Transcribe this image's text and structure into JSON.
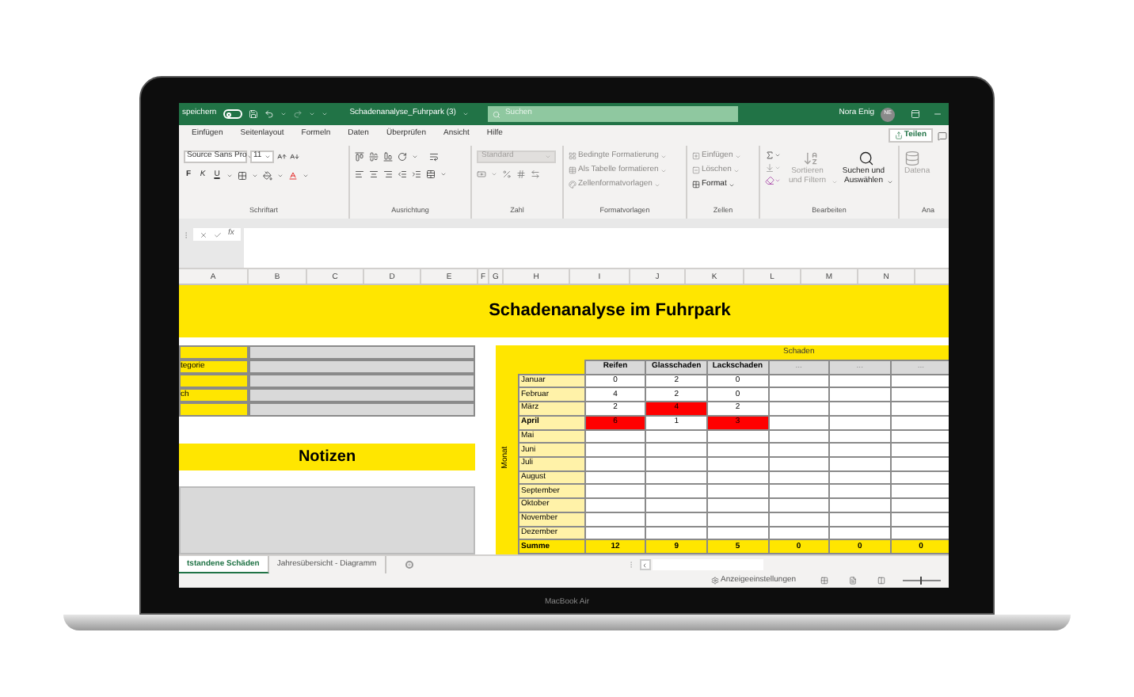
{
  "laptop": {
    "model": "MacBook Air"
  },
  "title_bar": {
    "autosave_label": "speichern",
    "autosave_on": false,
    "document_title": "Schadenanalyse_Fuhrpark (3)",
    "search_placeholder": "Suchen",
    "user_name": "Nora Enig",
    "user_initials": "NE"
  },
  "ribbon_tabs": [
    {
      "label": "Einfügen",
      "selected": false
    },
    {
      "label": "Seitenlayout",
      "selected": false
    },
    {
      "label": "Formeln",
      "selected": false
    },
    {
      "label": "Daten",
      "selected": false
    },
    {
      "label": "Überprüfen",
      "selected": false
    },
    {
      "label": "Ansicht",
      "selected": false
    },
    {
      "label": "Hilfe",
      "selected": false
    }
  ],
  "share_button": "Teilen",
  "ribbon": {
    "font_name": "Source Sans Pro",
    "font_size": "11",
    "style_buttons": [
      "F",
      "K",
      "U"
    ],
    "number_format": "Standard",
    "styles_commands": [
      "Bedingte Formatierung",
      "Als Tabelle formatieren",
      "Zellenformatvorlagen"
    ],
    "cells_commands": [
      "Einfügen",
      "Löschen",
      "Format"
    ],
    "edit_commands": [
      "Sortieren und Filtern",
      "Suchen und Auswählen"
    ],
    "cut_command": "Datena",
    "group_labels": [
      "Schriftart",
      "Ausrichtung",
      "Zahl",
      "Formatvorlagen",
      "Zellen",
      "Bearbeiten",
      "Ana"
    ]
  },
  "formula_bar": {
    "function_label": "fx"
  },
  "column_headers": [
    "A",
    "B",
    "C",
    "D",
    "E",
    "F",
    "G",
    "H",
    "I",
    "J",
    "K",
    "L",
    "M",
    "N"
  ],
  "sheet": {
    "title": "Schadenanalyse im Fuhrpark",
    "info_rows": [
      {
        "label": "tegorie"
      },
      {
        "label": "ch"
      }
    ],
    "notes_title": "Notizen",
    "damage_table": {
      "group_header": "Schaden",
      "axis_label": "Monat",
      "columns": [
        "Reifen",
        "Glasschaden",
        "Lackschaden",
        "...",
        "...",
        "..."
      ],
      "rows": [
        {
          "month": "Januar",
          "emphasized": false,
          "cells": [
            {
              "value": "0",
              "alert": false
            },
            {
              "value": "2",
              "alert": false
            },
            {
              "value": "0",
              "alert": false
            }
          ]
        },
        {
          "month": "Februar",
          "emphasized": false,
          "cells": [
            {
              "value": "4",
              "alert": false
            },
            {
              "value": "2",
              "alert": false
            },
            {
              "value": "0",
              "alert": false
            }
          ]
        },
        {
          "month": "März",
          "emphasized": false,
          "cells": [
            {
              "value": "2",
              "alert": false
            },
            {
              "value": "4",
              "alert": true
            },
            {
              "value": "2",
              "alert": false
            }
          ]
        },
        {
          "month": "April",
          "emphasized": true,
          "cells": [
            {
              "value": "6",
              "alert": true
            },
            {
              "value": "1",
              "alert": false
            },
            {
              "value": "3",
              "alert": true
            }
          ]
        },
        {
          "month": "Mai",
          "emphasized": false
        },
        {
          "month": "Juni",
          "emphasized": false
        },
        {
          "month": "Juli",
          "emphasized": false
        },
        {
          "month": "August",
          "emphasized": false
        },
        {
          "month": "September",
          "emphasized": false
        },
        {
          "month": "Oktober",
          "emphasized": false
        },
        {
          "month": "November",
          "emphasized": false
        },
        {
          "month": "Dezember",
          "emphasized": false
        }
      ],
      "total": {
        "label": "Summe",
        "values": [
          "12",
          "9",
          "5",
          "0",
          "0",
          "0"
        ]
      }
    }
  },
  "sheet_tabs": [
    {
      "label": "tstandene Schäden",
      "selected": true
    },
    {
      "label": "Jahresübersicht - Diagramm",
      "selected": false
    }
  ],
  "status_bar": {
    "display_settings": "Anzeigeeinstellungen",
    "zoom_slider": {
      "level": 0.5
    }
  }
}
